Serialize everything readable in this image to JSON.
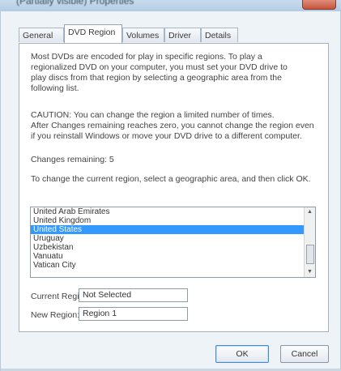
{
  "window": {
    "title": "(Partially visible) Properties",
    "colors": {
      "frame": "#eef3f8",
      "selection": "#3399ff",
      "titlebar": "#c9dcee",
      "close": "#c5543c"
    }
  },
  "tabs": [
    "General",
    "DVD Region",
    "Volumes",
    "Driver",
    "Details"
  ],
  "active_tab": "DVD Region",
  "content": {
    "intro_lines": [
      "Most DVDs are encoded for play in specific regions. To play a",
      "regionalized DVD on your computer, you must set your DVD drive to",
      "play discs from that region by selecting a geographic area from the",
      "following list."
    ],
    "caution_lines": [
      "CAUTION:  You can change the region a limited number of times.",
      "After Changes remaining reaches zero, you cannot change the region even",
      "if you reinstall Windows or move your DVD drive to a different computer."
    ],
    "changes_remaining": "Changes remaining: 5",
    "instruction": "To change the current region, select a geographic area, and then click OK."
  },
  "list": {
    "items": [
      "United Arab Emirates",
      "United Kingdom",
      "United States",
      "Uruguay",
      "Uzbekistan",
      "Vanuatu",
      "Vatican City"
    ],
    "selected": "United States"
  },
  "fields": {
    "current_region_label": "Current Region:",
    "current_region_value": "Not Selected",
    "new_region_label": "New Region:",
    "new_region_value": "Region 1"
  },
  "buttons": {
    "ok": "OK",
    "cancel": "Cancel"
  }
}
